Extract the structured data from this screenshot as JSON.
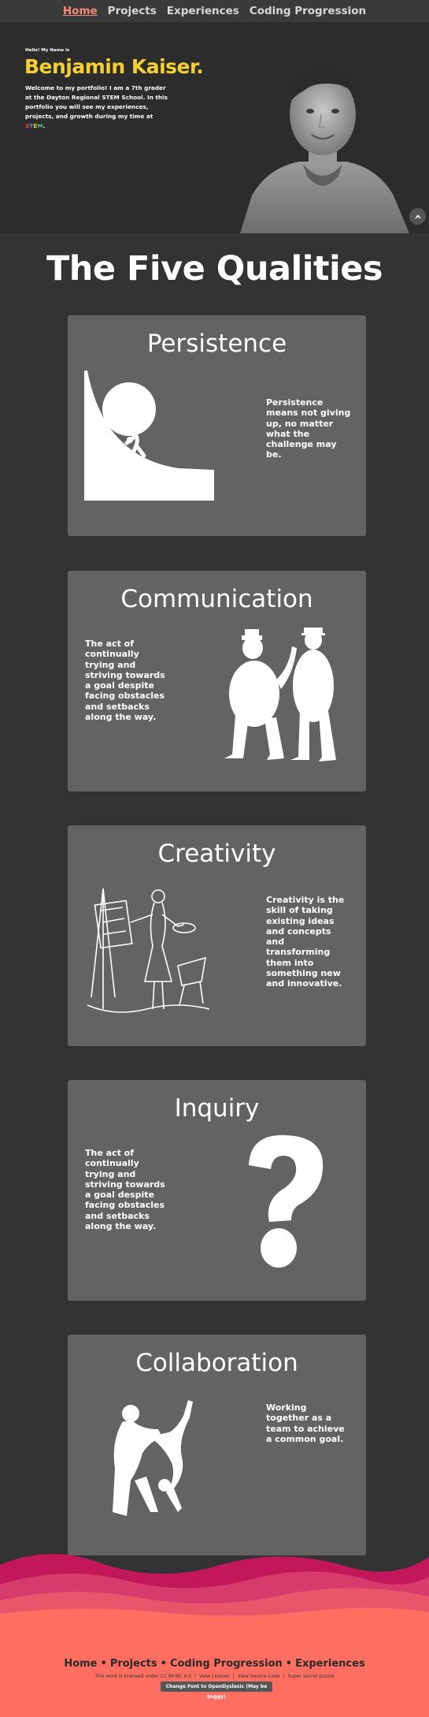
{
  "nav": {
    "items": [
      {
        "label": "Home",
        "active": true
      },
      {
        "label": "Projects",
        "active": false
      },
      {
        "label": "Experiences",
        "active": false
      },
      {
        "label": "Coding Progression",
        "active": false
      }
    ]
  },
  "hero": {
    "greeting": "Hello! My Name is",
    "name": "Benjamin Kaiser.",
    "intro": "Welcome to my portfolio! I am a 7th grader at the Dayton Regional STEM School. In this portfolio you will see my experiences, projects, and growth during my time at",
    "stem_letters": [
      "S",
      "T",
      "E",
      "M"
    ],
    "intro_end": "."
  },
  "qualities": {
    "title": "The Five Qualities",
    "cards": [
      {
        "title": "Persistence",
        "text": "Persistence means not giving up, no matter what the challenge may be.",
        "icon": "sisyphus-icon"
      },
      {
        "title": "Communication",
        "text": "The act of continually trying and striving towards a goal despite facing obstacles and setbacks along the way.",
        "icon": "two-men-talking-icon"
      },
      {
        "title": "Creativity",
        "text": "Creativity is the skill of taking existing ideas and concepts and transforming them into something new and innovative.",
        "icon": "painter-at-easel-icon"
      },
      {
        "title": "Inquiry",
        "text": "The act of continually trying and striving towards a goal despite facing obstacles and setbacks along the way.",
        "icon": "question-mark-icon"
      },
      {
        "title": "Collaboration",
        "text": "Working together as a team to achieve a common goal.",
        "icon": "dancers-icon"
      }
    ]
  },
  "footer": {
    "nav": [
      "Home",
      "Projects",
      "Coding Progression",
      "Experiences"
    ],
    "separator": "•",
    "license_text": "This work is licensed under CC BY-NC 4.0",
    "license_links": [
      "View License",
      "View Source Code",
      "Super secret puzzle"
    ],
    "link_separator": "|",
    "font_button": "Change Font to OpenDyslexic (May be buggy)"
  },
  "colors": {
    "accent_name": "#f5d033",
    "nav_active": "#f48a7a",
    "card_bg": "#636363",
    "page_bg": "#333333",
    "footer_bg": "#ff6f61"
  }
}
